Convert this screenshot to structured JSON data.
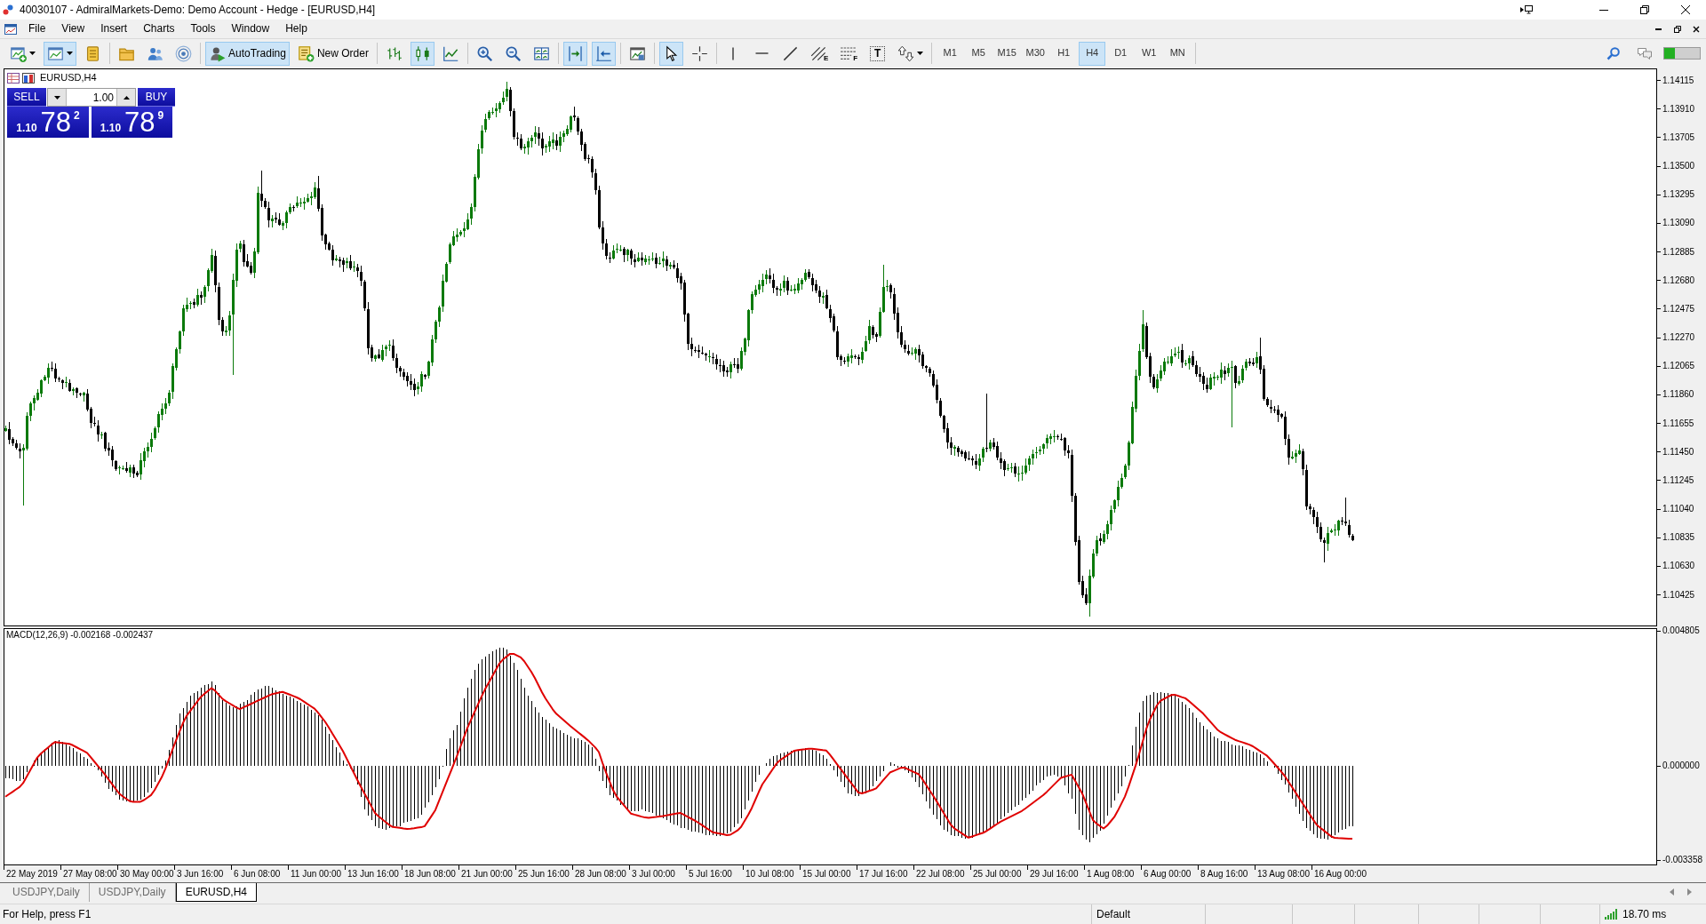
{
  "window": {
    "title": "40030107 - AdmiralMarkets-Demo: Demo Account - Hedge - [EURUSD,H4]"
  },
  "menu": [
    "File",
    "View",
    "Insert",
    "Charts",
    "Tools",
    "Window",
    "Help"
  ],
  "toolbar": {
    "groups": [
      [
        {
          "kind": "newchart",
          "pressed": false,
          "dropdown": true
        },
        {
          "kind": "profiles",
          "pressed": true,
          "dropdown": true
        },
        {
          "kind": "marketwatch",
          "pressed": false
        }
      ],
      [
        {
          "kind": "navigator",
          "pressed": false
        },
        {
          "kind": "terminal",
          "pressed": false
        },
        {
          "kind": "tester",
          "pressed": false
        }
      ],
      [
        {
          "kind": "autotrading",
          "label": "AutoTrading",
          "pressed": true
        },
        {
          "kind": "neworder",
          "label": "New Order",
          "pressed": false
        }
      ],
      [
        {
          "kind": "bars",
          "pressed": false
        },
        {
          "kind": "candles",
          "pressed": true
        },
        {
          "kind": "line",
          "pressed": false
        }
      ],
      [
        {
          "kind": "zoomin",
          "pressed": false
        },
        {
          "kind": "zoomout",
          "pressed": false
        },
        {
          "kind": "tile",
          "pressed": false
        }
      ],
      [
        {
          "kind": "shift",
          "pressed": true
        },
        {
          "kind": "autoscroll",
          "pressed": true
        }
      ],
      [
        {
          "kind": "templates",
          "pressed": false
        }
      ],
      [
        {
          "kind": "cursor",
          "pressed": true
        },
        {
          "kind": "crosshair",
          "pressed": false
        }
      ],
      [
        {
          "kind": "vline",
          "pressed": false
        },
        {
          "kind": "hline",
          "pressed": false
        },
        {
          "kind": "trend",
          "pressed": false
        },
        {
          "kind": "channel",
          "glyph": "E",
          "pressed": false
        },
        {
          "kind": "fibo",
          "glyph": "F",
          "pressed": false
        },
        {
          "kind": "text",
          "glyph": "T",
          "pressed": false
        },
        {
          "kind": "arrows",
          "pressed": false,
          "dropdown": true
        }
      ]
    ],
    "timeframes": [
      {
        "label": "M1",
        "selected": false
      },
      {
        "label": "M5",
        "selected": false
      },
      {
        "label": "M15",
        "selected": false
      },
      {
        "label": "M30",
        "selected": false
      },
      {
        "label": "H1",
        "selected": false
      },
      {
        "label": "H4",
        "selected": true
      },
      {
        "label": "D1",
        "selected": false
      },
      {
        "label": "W1",
        "selected": false
      },
      {
        "label": "MN",
        "selected": false
      }
    ],
    "meter": {
      "level": 0.3
    }
  },
  "chart": {
    "title": "EURUSD,H4",
    "trade_panel": {
      "sell_label": "SELL",
      "buy_label": "BUY",
      "volume": "1.00",
      "sell_price": {
        "prefix": "1.10",
        "main": "78",
        "pip": "2"
      },
      "buy_price": {
        "prefix": "1.10",
        "main": "78",
        "pip": "9"
      }
    },
    "price_axis": [
      "1.14115",
      "1.13910",
      "1.13705",
      "1.13500",
      "1.13295",
      "1.13090",
      "1.12885",
      "1.12680",
      "1.12475",
      "1.12270",
      "1.12065",
      "1.11860",
      "1.11655",
      "1.11450",
      "1.11245",
      "1.11040",
      "1.10835",
      "1.10630",
      "1.10425"
    ],
    "indicator": {
      "label": "MACD(12,26,9) -0.002168 -0.002437",
      "axis": [
        "0.004805",
        "0.000000",
        "-0.003358"
      ]
    },
    "time_axis": [
      "22 May 2019",
      "27 May 08:00",
      "30 May 00:00",
      "3 Jun 16:00",
      "6 Jun 08:00",
      "11 Jun 00:00",
      "13 Jun 16:00",
      "18 Jun 08:00",
      "21 Jun 00:00",
      "25 Jun 16:00",
      "28 Jun 08:00",
      "3 Jul 00:00",
      "5 Jul 16:00",
      "10 Jul 08:00",
      "15 Jul 00:00",
      "17 Jul 16:00",
      "22 Jul 08:00",
      "25 Jul 00:00",
      "29 Jul 16:00",
      "1 Aug 08:00",
      "6 Aug 00:00",
      "8 Aug 16:00",
      "13 Aug 08:00",
      "16 Aug 00:00"
    ]
  },
  "chart_tabs": [
    {
      "label": "USDJPY,Daily",
      "selected": false
    },
    {
      "label": "USDJPY,Daily",
      "selected": false
    },
    {
      "label": "EURUSD,H4",
      "selected": true
    }
  ],
  "status_bar": {
    "help": "For Help, press F1",
    "profile": "Default",
    "ping": "18.70 ms"
  }
}
